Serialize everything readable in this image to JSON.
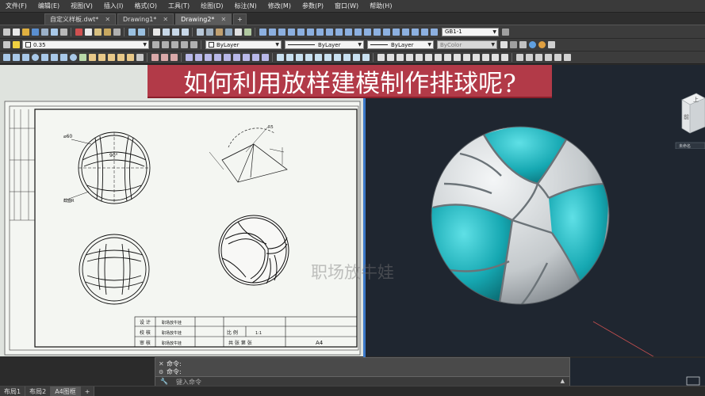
{
  "menu": [
    "文件(F)",
    "编辑(E)",
    "视图(V)",
    "插入(I)",
    "格式(O)",
    "工具(T)",
    "绘图(D)",
    "标注(N)",
    "修改(M)",
    "参数(P)",
    "窗口(W)",
    "帮助(H)"
  ],
  "file_tabs": [
    {
      "label": "自定义样板.dwt*",
      "active": false
    },
    {
      "label": "Drawing1*",
      "active": false
    },
    {
      "label": "Drawing2*",
      "active": true
    }
  ],
  "add_tab": "+",
  "toolbar": {
    "dimstyle": "GB1-1",
    "lineweight": "0.35",
    "color": "ByLayer",
    "linetype": "ByLayer",
    "lineweight2": "ByLayer",
    "plotstyle": "ByColor"
  },
  "banner": "如何利用放样建模制作排球呢?",
  "watermark": "职场放牛娃",
  "drawing": {
    "dim_diameter": "⌀60",
    "dim_angle": "90°",
    "dim_label_bottom": "截面R",
    "dim_radius": "R5",
    "titleblock": {
      "r1c1": "设 计",
      "r1c2": "职场放牛娃",
      "r2c1": "校 核",
      "r2c2": "职场放牛娃",
      "r3c1": "审 核",
      "r3c2": "职场放牛娃",
      "scale_label": "比 例",
      "scale_value": "1:1",
      "sheets": "共 张 第 张",
      "paper": "A4"
    }
  },
  "viewcube": {
    "top": "上",
    "front": "前",
    "wcs": "未命名"
  },
  "command": {
    "line1": "命令:",
    "line2": "命令:",
    "placeholder": "键入命令"
  },
  "layout_tabs": [
    "布局1",
    "布局2",
    "A4图框",
    "+"
  ],
  "colors": {
    "accent": "#3a78c8",
    "banner": "#b23a48",
    "ball_cyan": "#1fb3bd",
    "ball_white": "#d8dcde",
    "drawing_bg": "#dfe3de",
    "model_bg": "#1f2630"
  }
}
